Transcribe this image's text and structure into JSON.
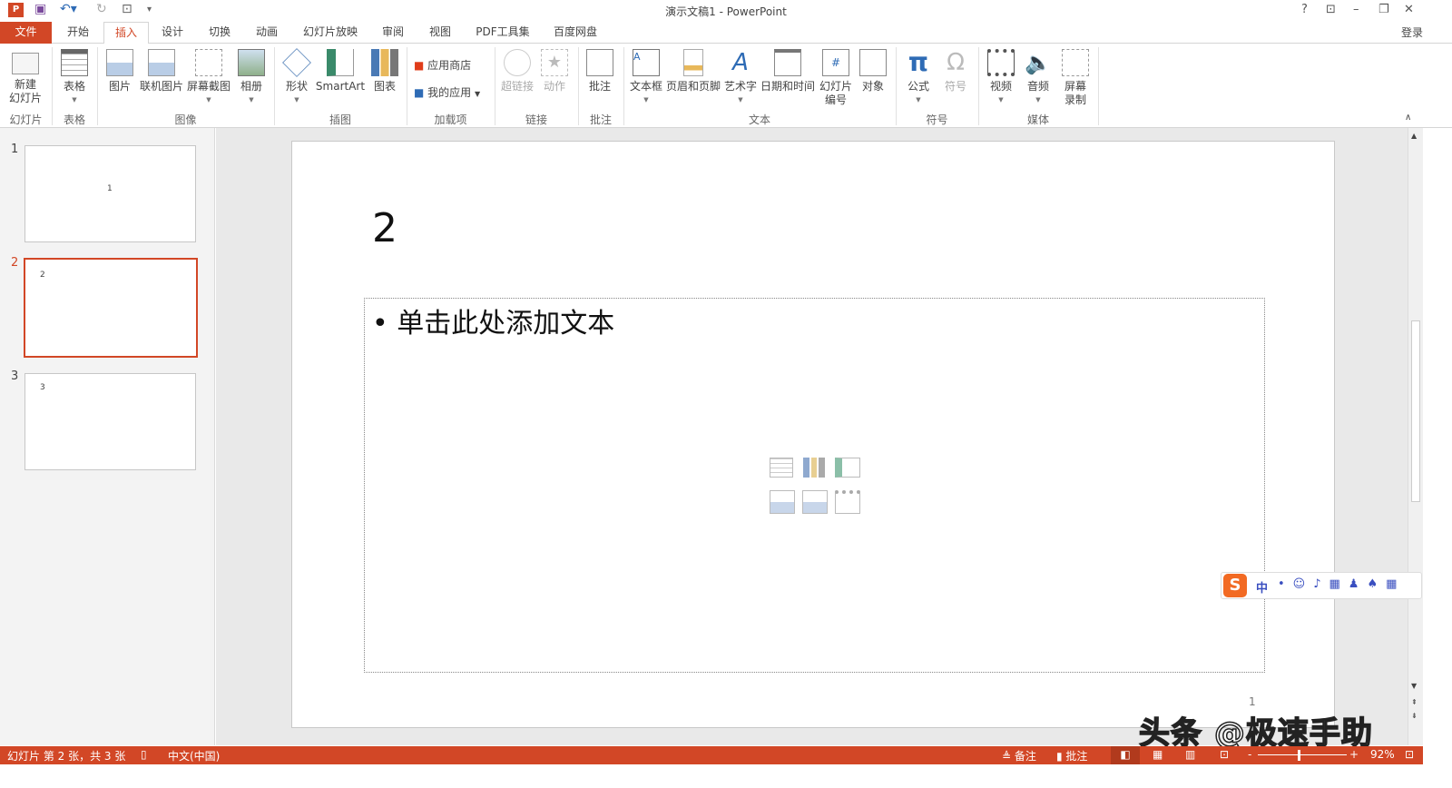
{
  "title": "演示文稿1 - PowerPoint",
  "window_buttons": {
    "help": "?",
    "ribbon_opts": "⊡",
    "min": "–",
    "restore": "❐",
    "close": "✕"
  },
  "login": "登录",
  "tabs": [
    "文件",
    "开始",
    "插入",
    "设计",
    "切换",
    "动画",
    "幻灯片放映",
    "审阅",
    "视图",
    "PDF工具集",
    "百度网盘"
  ],
  "active_tab": "插入",
  "ribbon": {
    "buttons": {
      "new_slide": "新建\n幻灯片",
      "table": "表格",
      "picture": "图片",
      "online_picture": "联机图片",
      "screenshot": "屏幕截图",
      "album": "相册",
      "shapes": "形状",
      "smartart": "SmartArt",
      "chart": "图表",
      "store": "应用商店",
      "my_apps": "我的应用",
      "hyperlink": "超链接",
      "action": "动作",
      "comment": "批注",
      "textbox": "文本框",
      "header_footer": "页眉和页脚",
      "wordart": "艺术字",
      "datetime": "日期和时间",
      "slide_number": "幻灯片\n编号",
      "object": "对象",
      "equation": "公式",
      "symbol": "符号",
      "video": "视频",
      "audio": "音频",
      "screen_record": "屏幕\n录制"
    },
    "groups": {
      "slides": "幻灯片",
      "tables": "表格",
      "images": "图像",
      "illustrations": "插图",
      "addins": "加载项",
      "links": "链接",
      "comments": "批注",
      "text": "文本",
      "symbols": "符号",
      "media": "媒体"
    }
  },
  "thumbnails": [
    {
      "num": "1",
      "text": "1"
    },
    {
      "num": "2",
      "text": "2",
      "selected": true
    },
    {
      "num": "3",
      "text": "3"
    }
  ],
  "slide": {
    "title": "2",
    "body_placeholder": "单击此处添加文本",
    "page_number": "1"
  },
  "status": {
    "slide_info": "幻灯片 第 2 张，共 3 张",
    "language": "中文(中国)",
    "notes": "备注",
    "comments": "批注",
    "zoom": "92%"
  },
  "ime": {
    "lang": "中"
  },
  "watermark": "头条 @极速手助",
  "colors": {
    "accent": "#D24726"
  }
}
